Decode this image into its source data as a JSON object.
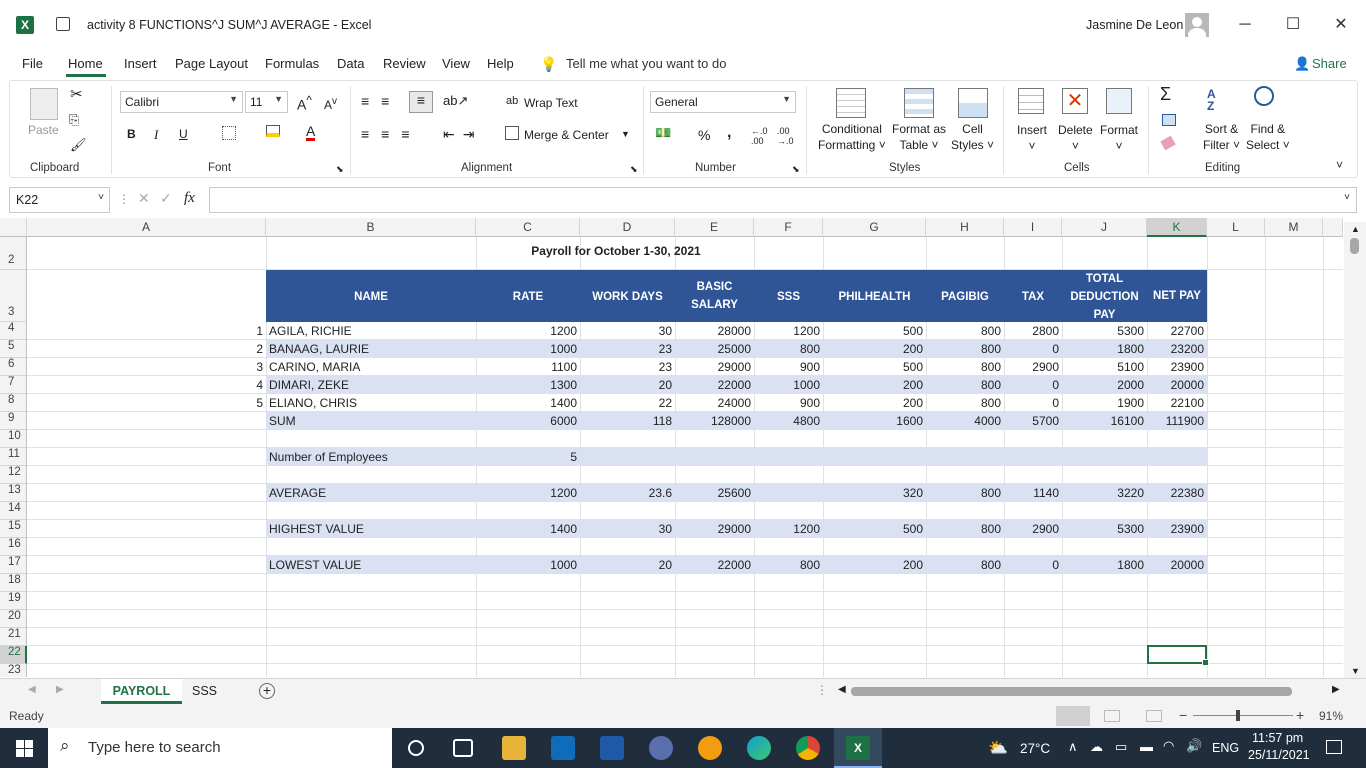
{
  "window": {
    "title": "activity 8 FUNCTIONS^J SUM^J AVERAGE  -  Excel",
    "user": "Jasmine De Leon",
    "minimize": "─",
    "maximize": "☐",
    "close": "✕"
  },
  "menu": {
    "items": [
      "File",
      "Home",
      "Insert",
      "Page Layout",
      "Formulas",
      "Data",
      "Review",
      "View",
      "Help"
    ],
    "tell_me": "Tell me what you want to do",
    "share": "Share"
  },
  "ribbon": {
    "clipboard": {
      "paste": "Paste",
      "label": "Clipboard"
    },
    "font": {
      "family": "Calibri",
      "size": "11",
      "bold": "B",
      "italic": "I",
      "underline": "U",
      "label": "Font"
    },
    "alignment": {
      "wrap": "Wrap Text",
      "merge": "Merge & Center",
      "label": "Alignment"
    },
    "number": {
      "format": "General",
      "percent": "%",
      "comma": ",",
      "label": "Number"
    },
    "styles": {
      "conditional": [
        "Conditional",
        "Formatting"
      ],
      "format_table": [
        "Format as",
        "Table"
      ],
      "cell_styles": [
        "Cell",
        "Styles"
      ],
      "label": "Styles"
    },
    "cells": {
      "insert": "Insert",
      "delete": "Delete",
      "format": "Format",
      "label": "Cells"
    },
    "editing": {
      "sum": "Σ",
      "sort": [
        "Sort &",
        "Filter"
      ],
      "find": [
        "Find &",
        "Select"
      ],
      "label": "Editing"
    }
  },
  "formula_bar": {
    "name_box": "K22",
    "fx": "fx",
    "value": ""
  },
  "sheet": {
    "columns": [
      "A",
      "B",
      "C",
      "D",
      "E",
      "F",
      "G",
      "H",
      "I",
      "J",
      "K",
      "L",
      "M"
    ],
    "rows": [
      "2",
      "3",
      "4",
      "5",
      "6",
      "7",
      "8",
      "9",
      "10",
      "11",
      "12",
      "13",
      "14",
      "15",
      "16",
      "17",
      "18",
      "19",
      "20",
      "21",
      "22",
      "23"
    ],
    "title": "Payroll for October 1-30, 2021",
    "headers": {
      "name": "NAME",
      "rate": "RATE",
      "work_days": "WORK DAYS",
      "basic_salary": [
        "BASIC",
        "SALARY"
      ],
      "sss": "SSS",
      "philhealth": "PHILHEALTH",
      "pagibig": "PAGIBIG",
      "tax": "TAX",
      "total_deduction": [
        "TOTAL",
        "DEDUCTION",
        "PAY"
      ],
      "net_pay": "NET PAY"
    },
    "employees": [
      {
        "no": "1",
        "name": "AGILA, RICHIE",
        "rate": "1200",
        "days": "30",
        "basic": "28000",
        "sss": "1200",
        "phil": "500",
        "pagibig": "800",
        "tax": "2800",
        "total": "5300",
        "net": "22700"
      },
      {
        "no": "2",
        "name": "BANAAG, LAURIE",
        "rate": "1000",
        "days": "23",
        "basic": "25000",
        "sss": "800",
        "phil": "200",
        "pagibig": "800",
        "tax": "0",
        "total": "1800",
        "net": "23200"
      },
      {
        "no": "3",
        "name": "CARINO, MARIA",
        "rate": "1100",
        "days": "23",
        "basic": "29000",
        "sss": "900",
        "phil": "500",
        "pagibig": "800",
        "tax": "2900",
        "total": "5100",
        "net": "23900"
      },
      {
        "no": "4",
        "name": "DIMARI, ZEKE",
        "rate": "1300",
        "days": "20",
        "basic": "22000",
        "sss": "1000",
        "phil": "200",
        "pagibig": "800",
        "tax": "0",
        "total": "2000",
        "net": "20000"
      },
      {
        "no": "5",
        "name": "ELIANO, CHRIS",
        "rate": "1400",
        "days": "22",
        "basic": "24000",
        "sss": "900",
        "phil": "200",
        "pagibig": "800",
        "tax": "0",
        "total": "1900",
        "net": "22100"
      }
    ],
    "sum": {
      "label": "SUM",
      "rate": "6000",
      "days": "118",
      "basic": "128000",
      "sss": "4800",
      "phil": "1600",
      "pagibig": "4000",
      "tax": "5700",
      "total": "16100",
      "net": "111900"
    },
    "count": {
      "label": "Number of Employees",
      "value": "5"
    },
    "average": {
      "label": "AVERAGE",
      "rate": "1200",
      "days": "23.6",
      "basic": "25600",
      "sss": "",
      "phil": "320",
      "pagibig": "800",
      "tax": "1140",
      "total": "3220",
      "net": "22380"
    },
    "highest": {
      "label": "HIGHEST VALUE",
      "rate": "1400",
      "days": "30",
      "basic": "29000",
      "sss": "1200",
      "phil": "500",
      "pagibig": "800",
      "tax": "2900",
      "total": "5300",
      "net": "23900"
    },
    "lowest": {
      "label": "LOWEST VALUE",
      "rate": "1000",
      "days": "20",
      "basic": "22000",
      "sss": "800",
      "phil": "200",
      "pagibig": "800",
      "tax": "0",
      "total": "1800",
      "net": "20000"
    }
  },
  "tabs": [
    "PAYROLL",
    "SSS"
  ],
  "status": {
    "text": "Ready",
    "zoom": "91%"
  },
  "taskbar": {
    "search_placeholder": "Type here to search",
    "weather": "27°C",
    "lang": "ENG",
    "time": "11:57 pm",
    "date": "25/11/2021"
  }
}
